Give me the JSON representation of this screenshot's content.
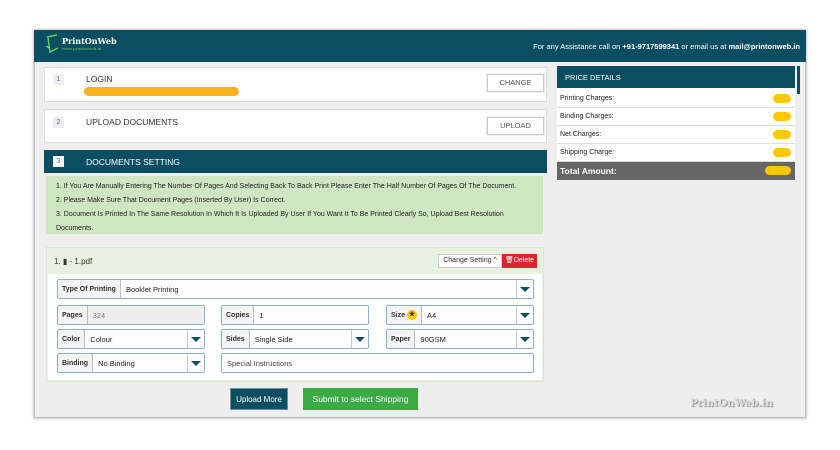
{
  "header": {
    "brand": "PrintOnWeb",
    "brand_url": "www.printonweb.in",
    "assist_prefix": "For any Assistance call on ",
    "phone": "+91-9717599341",
    "assist_mid": " or email us at ",
    "email": "mail@printonweb.in"
  },
  "steps": [
    {
      "num": "1",
      "title": "LOGIN",
      "button": "CHANGE"
    },
    {
      "num": "2",
      "title": "UPLOAD DOCUMENTS",
      "button": "UPLOAD"
    },
    {
      "num": "3",
      "title": "DOCUMENTS SETTING"
    }
  ],
  "notes": [
    "1. If You Are Manually Entering The Number Of Pages And Selecting Back To Back Print Please Enter The Half Number Of Pages Of The Document.",
    "2. Please Make Sure That Document Pages (Inserted By User) Is Correct.",
    "3. Document Is Printed In The Same Resolution In Which It Is Uploaded By User If You Want It To Be Printed Clearly So, Upload Best Resolution Documents."
  ],
  "file": {
    "index": "1.",
    "name": "- 1.pdf",
    "change_setting": "Change Setting",
    "delete": "Delete"
  },
  "form": {
    "type_label": "Type Of Printing",
    "type_value": "Booklet Printing",
    "pages_label": "Pages",
    "pages_value": "324",
    "copies_label": "Copies",
    "copies_value": "1",
    "size_label": "Size",
    "size_value": "A4",
    "color_label": "Color",
    "color_value": "Colour",
    "sides_label": "Sides",
    "sides_value": "Single Side",
    "paper_label": "Paper",
    "paper_value": "90GSM",
    "binding_label": "Binding",
    "binding_value": "No Binding",
    "instructions_placeholder": "Special Instructions"
  },
  "actions": {
    "upload_more": "Upload More",
    "submit": "Submit to select Shipping"
  },
  "price": {
    "title": "PRICE DETAILS",
    "rows": [
      "Printing Charges:",
      "Binding Charges:",
      "Net Charges:",
      "Shipping Charge:"
    ],
    "total": "Total Amount:"
  },
  "watermark": "PrintOnWeb.in",
  "colors": {
    "primary": "#0b4e62",
    "success": "#3aaa45",
    "danger": "#d9262e",
    "redaction": "#ffc800"
  }
}
